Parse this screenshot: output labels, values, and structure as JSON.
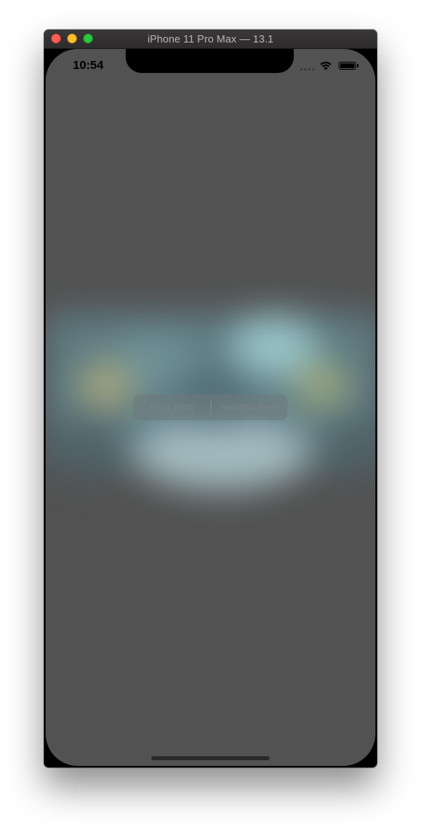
{
  "window": {
    "title": "iPhone 11 Pro Max — 13.1"
  },
  "statusbar": {
    "time": "10:54",
    "signal_icon": "cellular-signal-icon",
    "wifi_icon": "wifi-icon",
    "battery_icon": "battery-icon",
    "battery_level": 1.0
  },
  "segmented_control": {
    "segments": [
      {
        "label": "First Item"
      },
      {
        "label": "Second Item"
      }
    ]
  },
  "colors": {
    "overlay": "#525252",
    "titlebar": "#3b3839",
    "close": "#fe5f57",
    "minimize": "#febc2e",
    "maximize": "#28c840"
  }
}
